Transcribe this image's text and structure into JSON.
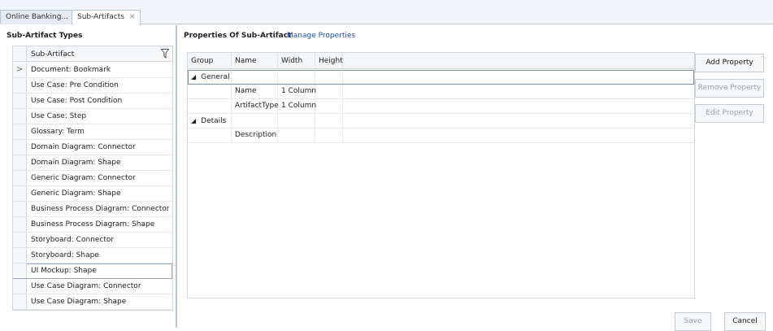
{
  "tabs": [
    {
      "label": "Online Banking..."
    },
    {
      "label": "Sub-Artifacts",
      "close": "×"
    }
  ],
  "left": {
    "title": "Sub-Artifact Types",
    "column_header": "Sub-Artifact",
    "selected_indicator": ">",
    "rows": [
      "Document: Bookmark",
      "Use Case: Pre Condition",
      "Use Case: Post Condition",
      "Use Case: Step",
      "Glossary: Term",
      "Domain Diagram: Connector",
      "Domain Diagram: Shape",
      "Generic Diagram: Connector",
      "Generic Diagram: Shape",
      "Business Process Diagram: Connector",
      "Business Process Diagram: Shape",
      "Storyboard: Connector",
      "Storyboard: Shape",
      "UI Mockup: Shape",
      "Use Case Diagram: Connector",
      "Use Case Diagram: Shape"
    ]
  },
  "right": {
    "title": "Properties Of Sub-Artifact",
    "manage_link": "Manage Properties",
    "columns": [
      "Group",
      "Name",
      "Width",
      "Height"
    ],
    "groups": [
      {
        "name": "General",
        "expander": "◢",
        "rows": [
          {
            "name": "Name",
            "width": "1 Column"
          },
          {
            "name": "ArtifactType",
            "width": "1 Column"
          }
        ]
      },
      {
        "name": "Details",
        "expander": "◢",
        "rows": [
          {
            "name": "Description",
            "width": ""
          }
        ]
      }
    ],
    "buttons": {
      "add": "Add Property",
      "remove": "Remove Property",
      "edit": "Edit Property",
      "save": "Save",
      "cancel": "Cancel"
    }
  }
}
